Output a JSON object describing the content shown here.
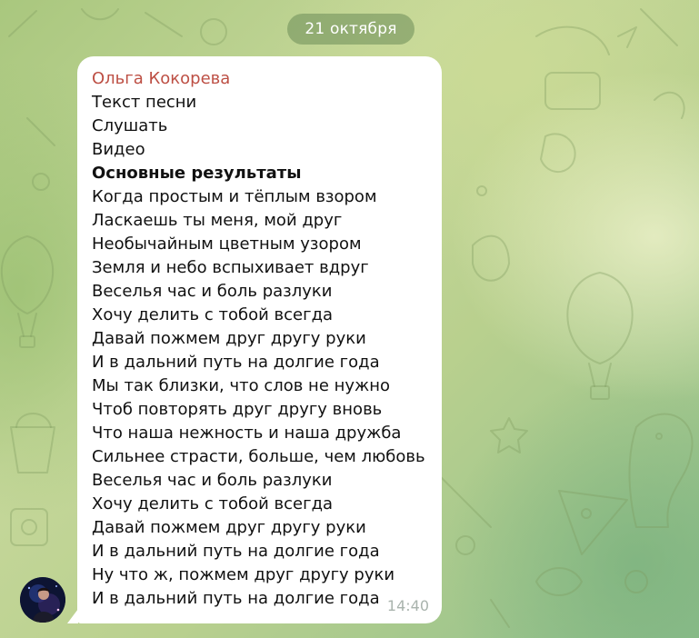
{
  "chat": {
    "date_label": "21 октября"
  },
  "message": {
    "sender": "Ольга Кокорева",
    "lines": [
      "Текст песни",
      "Слушать",
      "Видео",
      "Основные результаты",
      "Когда простым и тёплым взором",
      "Ласкаешь ты меня, мой друг",
      "Необычайным цветным узором",
      "Земля и небо вспыхивает вдруг",
      "Веселья час и боль разлуки",
      "Хочу делить с тобой всегда",
      "Давай пожмем друг другу руки",
      "И в дальний путь на долгие года",
      "Мы так близки, что слов не нужно",
      "Чтоб повторять друг другу вновь",
      "Что наша нежность и наша дружба",
      "Сильнее страсти, больше, чем любовь",
      "Веселья час и боль разлуки",
      "Хочу делить с тобой всегда",
      "Давай пожмем друг другу руки",
      "И в дальний путь на долгие года",
      "Ну что ж, пожмем друг другу руки",
      "И в дальний путь на долгие года"
    ],
    "time": "14:40"
  },
  "colors": {
    "sender_name": "#bd4f44",
    "bubble": "#ffffff",
    "date_pill": "#6c8c58"
  },
  "icons": {
    "avatar": "user-avatar-photo"
  }
}
